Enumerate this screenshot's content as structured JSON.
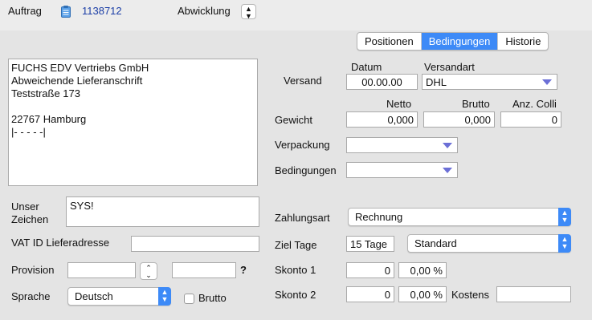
{
  "header": {
    "auftrag_label": "Auftrag",
    "order_icon": "clipboard-icon",
    "order_number": "1138712",
    "abwicklung_label": "Abwicklung"
  },
  "tabs": [
    {
      "label": "Positionen",
      "active": false
    },
    {
      "label": "Bedingungen",
      "active": true
    },
    {
      "label": "Historie",
      "active": false
    }
  ],
  "address": {
    "lines": [
      "FUCHS EDV Vertriebs GmbH",
      "Abweichende Lieferanschrift",
      "Teststraße 173",
      "",
      "22767 Hamburg",
      "|- - - - -|"
    ]
  },
  "left": {
    "unser_zeichen_label_1": "Unser",
    "unser_zeichen_label_2": "Zeichen",
    "unser_zeichen_value": "SYS!",
    "vat_label": "VAT ID Lieferadresse",
    "vat_value": "",
    "provision_label": "Provision",
    "provision_value_1": "",
    "provision_value_2": "",
    "provision_help": "?",
    "sprache_label": "Sprache",
    "sprache_value": "Deutsch",
    "brutto_label": "Brutto"
  },
  "right": {
    "datum_header": "Datum",
    "versandart_header": "Versandart",
    "versand_label": "Versand",
    "datum_value": "00.00.00",
    "versandart_value": "DHL",
    "netto_header": "Netto",
    "brutto_header": "Brutto",
    "colli_header": "Anz. Colli",
    "gewicht_label": "Gewicht",
    "netto_value": "0,000",
    "brutto_value": "0,000",
    "colli_value": "0",
    "verpackung_label": "Verpackung",
    "verpackung_value": "",
    "bedingungen_label": "Bedingungen",
    "bedingungen_value": "",
    "zahlungsart_label": "Zahlungsart",
    "zahlungsart_value": "Rechnung",
    "ziel_tage_label": "Ziel Tage",
    "ziel_tage_value": "15 Tage",
    "ziel_mode_value": "Standard",
    "skonto1_label": "Skonto 1",
    "skonto1_days": "0",
    "skonto1_pct": "0,00 %",
    "skonto2_label": "Skonto 2",
    "skonto2_days": "0",
    "skonto2_pct": "0,00 %",
    "kostens_label": "Kostens",
    "kostens_value": ""
  },
  "colors": {
    "accent": "#3d8af7",
    "link": "#1a3da6",
    "popup_arrow": "#6b6fd6"
  }
}
